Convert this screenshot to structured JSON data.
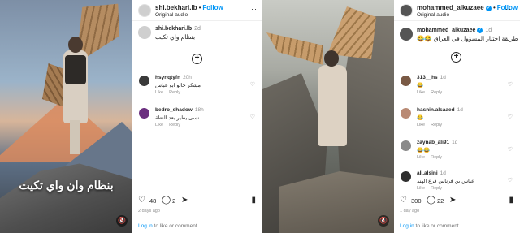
{
  "left_post": {
    "video": {
      "overlay_text": "بنظام وان واي تكيت",
      "mute_icon": "speaker-muted-icon"
    },
    "header": {
      "username": "shi.bekhari.lb",
      "separator": "•",
      "follow_label": "Follow",
      "subtitle": "Original audio",
      "more_icon": "···"
    },
    "caption": {
      "username": "shi.bekhari.lb",
      "time": "2d",
      "text": "بنظام واي تكيت"
    },
    "load_more_icon": "+",
    "comments": [
      {
        "username": "hsynqtyfn",
        "time": "20h",
        "text": "مشكر حالو ابو عباس",
        "reply_label": "Reply",
        "like_label": "Like"
      },
      {
        "username": "bedro_shadow",
        "time": "18h",
        "text": "نسى يطير بعد النطة",
        "reply_label": "Reply",
        "like_label": "Like"
      }
    ],
    "actions": {
      "likes": "48",
      "comments": "2"
    },
    "date": "2 days ago",
    "login_link": "Log in",
    "login_rest": " to like or comment."
  },
  "right_post": {
    "video": {
      "mute_icon": "speaker-muted-icon"
    },
    "header": {
      "username": "mohammed_alkuzaee",
      "verified": "✓",
      "separator": "•",
      "follow_label": "Follow",
      "subtitle": "Original audio",
      "more_icon": "···"
    },
    "caption": {
      "username": "mohammed_alkuzaee",
      "verified": "✓",
      "time": "1d",
      "text": "طريقة اختيار المسؤول في العراق 😂😂"
    },
    "load_more_icon": "+",
    "comments": [
      {
        "username": "313__hs",
        "time": "1d",
        "text": "😂",
        "reply_label": "Reply",
        "like_label": "Like"
      },
      {
        "username": "hasnin.alsaaed",
        "time": "1d",
        "text": "😂",
        "reply_label": "Reply",
        "like_label": "Like"
      },
      {
        "username": "zaynab_ali91",
        "time": "1d",
        "text": "😂😂",
        "reply_label": "Reply",
        "like_label": "Like"
      },
      {
        "username": "ali.alsini",
        "time": "1d",
        "text": "عباس بن فرناس فرع الهند",
        "reply_label": "Reply",
        "like_label": "Like"
      }
    ],
    "actions": {
      "likes": "300",
      "comments": "22"
    },
    "date": "1 day ago",
    "login_link": "Log in",
    "login_rest": " to like or comment."
  },
  "colors": {
    "accent": "#0095f6",
    "muted_text": "#8e8e8e",
    "text": "#262626"
  }
}
